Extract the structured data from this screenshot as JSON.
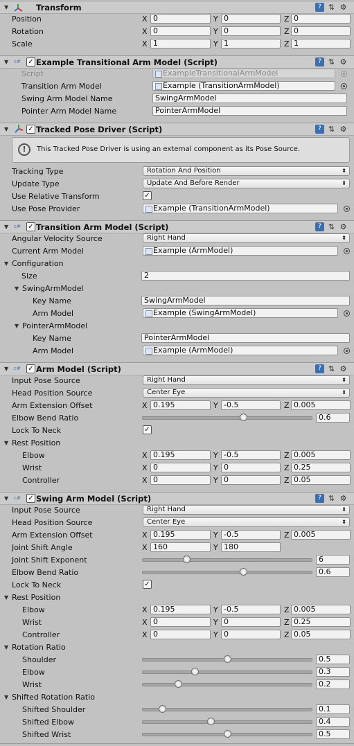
{
  "transform": {
    "title": "Transform",
    "rows": [
      {
        "label": "Position",
        "x": "0",
        "y": "0",
        "z": "0"
      },
      {
        "label": "Rotation",
        "x": "0",
        "y": "0",
        "z": "0"
      },
      {
        "label": "Scale",
        "x": "1",
        "y": "1",
        "z": "1"
      }
    ]
  },
  "axes": {
    "x": "X",
    "y": "Y",
    "z": "Z"
  },
  "etam": {
    "title": "Example Transitional Arm Model (Script)",
    "script_label": "Script",
    "script_value": "ExampleTransitionalArmModel",
    "tam_label": "Transition Arm Model",
    "tam_value": "Example (TransitionArmModel)",
    "swing_name_label": "Swing Arm Model Name",
    "swing_name_value": "SwingArmModel",
    "pointer_name_label": "Pointer Arm Model Name",
    "pointer_name_value": "PointerArmModel"
  },
  "tpd": {
    "title": "Tracked Pose Driver (Script)",
    "help": "This Tracked Pose Driver is using an external component as its Pose Source.",
    "tracking_label": "Tracking Type",
    "tracking_value": "Rotation And Position",
    "update_label": "Update Type",
    "update_value": "Update And Before Render",
    "relative_label": "Use Relative Transform",
    "relative_checked": true,
    "provider_label": "Use Pose Provider",
    "provider_value": "Example (TransitionArmModel)"
  },
  "tam": {
    "title": "Transition Arm Model (Script)",
    "angular_label": "Angular Velocity Source",
    "angular_value": "Right Hand",
    "current_label": "Current Arm Model",
    "current_value": "Example (ArmModel)",
    "config_label": "Configuration",
    "size_label": "Size",
    "size_value": "2",
    "items": [
      {
        "name": "SwingArmModel",
        "key_label": "Key Name",
        "key_value": "SwingArmModel",
        "arm_label": "Arm Model",
        "arm_value": "Example (SwingArmModel)"
      },
      {
        "name": "PointerArmModel",
        "key_label": "Key Name",
        "key_value": "PointerArmModel",
        "arm_label": "Arm Model",
        "arm_value": "Example (ArmModel)"
      }
    ]
  },
  "am": {
    "title": "Arm Model (Script)",
    "input_label": "Input Pose Source",
    "input_value": "Right Hand",
    "head_label": "Head Position Source",
    "head_value": "Center Eye",
    "ext_label": "Arm Extension Offset",
    "ext_x": "0.195",
    "ext_y": "-0.5",
    "ext_z": "0.005",
    "elbow_ratio_label": "Elbow Bend Ratio",
    "elbow_ratio_value": "0.6",
    "elbow_ratio_frac": 0.6,
    "lock_label": "Lock To Neck",
    "lock_checked": true,
    "rest_label": "Rest Position",
    "rest": [
      {
        "label": "Elbow",
        "x": "0.195",
        "y": "-0.5",
        "z": "0.005"
      },
      {
        "label": "Wrist",
        "x": "0",
        "y": "0",
        "z": "0.25"
      },
      {
        "label": "Controller",
        "x": "0",
        "y": "0",
        "z": "0.05"
      }
    ]
  },
  "sam": {
    "title": "Swing Arm Model (Script)",
    "input_label": "Input Pose Source",
    "input_value": "Right Hand",
    "head_label": "Head Position Source",
    "head_value": "Center Eye",
    "ext_label": "Arm Extension Offset",
    "ext_x": "0.195",
    "ext_y": "-0.5",
    "ext_z": "0.005",
    "joint_angle_label": "Joint Shift Angle",
    "joint_angle_x": "160",
    "joint_angle_y": "180",
    "joint_exp_label": "Joint Shift Exponent",
    "joint_exp_value": "6",
    "joint_exp_frac": 0.25,
    "elbow_ratio_label": "Elbow Bend Ratio",
    "elbow_ratio_value": "0.6",
    "elbow_ratio_frac": 0.6,
    "lock_label": "Lock To Neck",
    "lock_checked": true,
    "rest_label": "Rest Position",
    "rest": [
      {
        "label": "Elbow",
        "x": "0.195",
        "y": "-0.5",
        "z": "0.005"
      },
      {
        "label": "Wrist",
        "x": "0",
        "y": "0",
        "z": "0.25"
      },
      {
        "label": "Controller",
        "x": "0",
        "y": "0",
        "z": "0.05"
      }
    ],
    "rot_label": "Rotation Ratio",
    "rot": [
      {
        "label": "Shoulder",
        "value": "0.5",
        "frac": 0.5
      },
      {
        "label": "Elbow",
        "value": "0.3",
        "frac": 0.3
      },
      {
        "label": "Wrist",
        "value": "0.2",
        "frac": 0.2
      }
    ],
    "shifted_label": "Shifted Rotation Ratio",
    "shifted": [
      {
        "label": "Shifted Shoulder",
        "value": "0.1",
        "frac": 0.1
      },
      {
        "label": "Shifted Elbow",
        "value": "0.4",
        "frac": 0.4
      },
      {
        "label": "Shifted Wrist",
        "value": "0.5",
        "frac": 0.5
      }
    ]
  },
  "icons": {
    "foldout_open": "▼",
    "check": "✓",
    "dropdown": "⬍",
    "book": "?",
    "preset": "⇅",
    "gear": "⚙"
  }
}
